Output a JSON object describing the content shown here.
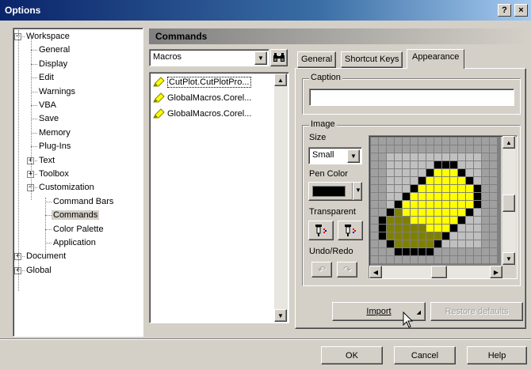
{
  "window": {
    "title": "Options",
    "help_glyph": "?",
    "close_glyph": "×"
  },
  "tree": [
    {
      "label": "Workspace",
      "level": 0,
      "toggle": "−"
    },
    {
      "label": "General",
      "level": 1
    },
    {
      "label": "Display",
      "level": 1
    },
    {
      "label": "Edit",
      "level": 1
    },
    {
      "label": "Warnings",
      "level": 1
    },
    {
      "label": "VBA",
      "level": 1
    },
    {
      "label": "Save",
      "level": 1
    },
    {
      "label": "Memory",
      "level": 1
    },
    {
      "label": "Plug-Ins",
      "level": 1
    },
    {
      "label": "Text",
      "level": 1,
      "toggle": "+"
    },
    {
      "label": "Toolbox",
      "level": 1,
      "toggle": "+"
    },
    {
      "label": "Customization",
      "level": 1,
      "toggle": "−"
    },
    {
      "label": "Command Bars",
      "level": 2
    },
    {
      "label": "Commands",
      "level": 2,
      "selected": true
    },
    {
      "label": "Color Palette",
      "level": 2
    },
    {
      "label": "Application",
      "level": 2
    },
    {
      "label": "Document",
      "level": 0,
      "toggle": "+"
    },
    {
      "label": "Global",
      "level": 0,
      "toggle": "+"
    }
  ],
  "header": {
    "title": "Commands"
  },
  "category": {
    "value": "Macros"
  },
  "commands": [
    {
      "label": "CutPlot.CutPlotPro...",
      "selected": true
    },
    {
      "label": "GlobalMacros.Corel..."
    },
    {
      "label": "GlobalMacros.Corel..."
    }
  ],
  "tabs": [
    {
      "label": "General",
      "active": false
    },
    {
      "label": "Shortcut Keys",
      "active": false
    },
    {
      "label": "Appearance",
      "active": true
    }
  ],
  "appearance": {
    "caption_label": "Caption",
    "caption_value": "",
    "image_label": "Image",
    "size_label": "Size",
    "size_value": "Small",
    "pen_color_label": "Pen Color",
    "pen_color": "#000000",
    "transparent_label": "Transparent",
    "undo_redo_label": "Undo/Redo",
    "import_label": "Import",
    "restore_label": "Restore defaults"
  },
  "footer": {
    "ok": "OK",
    "cancel": "Cancel",
    "help": "Help"
  },
  "colors": {
    "titlebar_start": "#0a246a",
    "face": "#d4d0c8",
    "icon_yellow": "#ffff00",
    "icon_olive": "#808000",
    "icon_light": "#c0c0c0",
    "icon_white": "#ffffff",
    "icon_black": "#000000"
  },
  "icon_pixels": [
    "................",
    "................",
    "................",
    "........KKK.....",
    ".......KYYYK....",
    "......KYYYYYK...",
    ".....KYYYYYYYK..",
    "....KYYYYYYYYK..",
    "...KYYYYYYYYYK..",
    "..KOYYYYYYYYK...",
    ".KOOOYYYYYYK....",
    ".KOOOOOYYYK.....",
    ".KOOOOOOOK......",
    "..KOOOOOK.......",
    "...KKKKK........",
    "................"
  ]
}
